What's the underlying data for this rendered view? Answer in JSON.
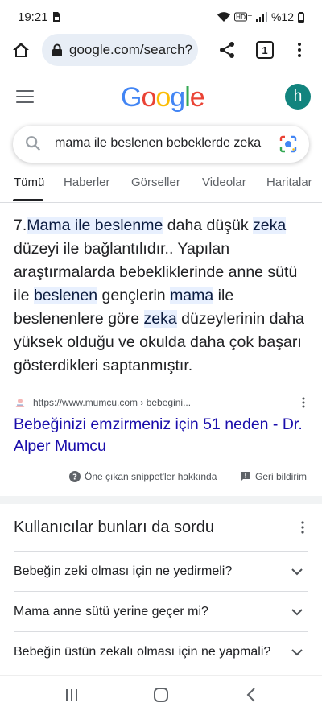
{
  "status_bar": {
    "time": "19:21",
    "battery": "%12",
    "icons": [
      "sim-icon",
      "wifi-icon",
      "hd-icon",
      "signal-icon",
      "battery-icon"
    ]
  },
  "browser": {
    "url": "google.com/search?",
    "tab_count": "1",
    "icons": [
      "home-icon",
      "lock-icon",
      "share-icon",
      "tab-switcher-icon",
      "more-vert-icon"
    ]
  },
  "google": {
    "logo": [
      "G",
      "o",
      "o",
      "g",
      "l",
      "e"
    ],
    "logo_colors": [
      "#4285F4",
      "#EA4335",
      "#FBBC05",
      "#4285F4",
      "#34A853",
      "#EA4335"
    ],
    "avatar_letter": "h",
    "avatar_color": "#12847e"
  },
  "search": {
    "query": "mama ile beslenen bebeklerde zeka"
  },
  "tabs": [
    {
      "label": "Tümü",
      "active": true
    },
    {
      "label": "Haberler"
    },
    {
      "label": "Görseller"
    },
    {
      "label": "Videolar"
    },
    {
      "label": "Haritalar"
    }
  ],
  "snippet": {
    "segments": [
      {
        "text": "7.",
        "hl": false
      },
      {
        "text": "Mama ile beslenme",
        "hl": true
      },
      {
        "text": " daha düşük ",
        "hl": false
      },
      {
        "text": "zeka",
        "hl": true
      },
      {
        "text": " düzeyi ile bağlantılıdır.. Yapılan araştırmalarda bebekliklerinde anne sütü ile ",
        "hl": false
      },
      {
        "text": "beslenen",
        "hl": true
      },
      {
        "text": " gençlerin ",
        "hl": false
      },
      {
        "text": "mama",
        "hl": true
      },
      {
        "text": " ile beslenenlere göre ",
        "hl": false
      },
      {
        "text": "zeka",
        "hl": true
      },
      {
        "text": " düzeylerinin daha yüksek olduğu ve okulda daha çok başarı gösterdikleri saptanmıştır.",
        "hl": false
      }
    ],
    "source_url": "https://www.mumcu.com › bebegini...",
    "result_title": "Bebeğinizi emzirmeniz için 51 neden - Dr. Alper Mumcu",
    "about_label": "Öne çıkan snippet'ler hakkında",
    "feedback_label": "Geri bildirim",
    "highlight_color": "#e8f0fe",
    "link_color": "#1a0dab"
  },
  "paa": {
    "title": "Kullanıcılar bunları da sordu",
    "questions": [
      "Bebeğin zeki olması için ne yedirmeli?",
      "Mama anne sütü yerine geçer mi?",
      "Bebeğin üstün zekalı olması için ne yapmali?"
    ]
  },
  "nav_icons": [
    "recent-apps-icon",
    "home-button-icon",
    "back-icon"
  ]
}
